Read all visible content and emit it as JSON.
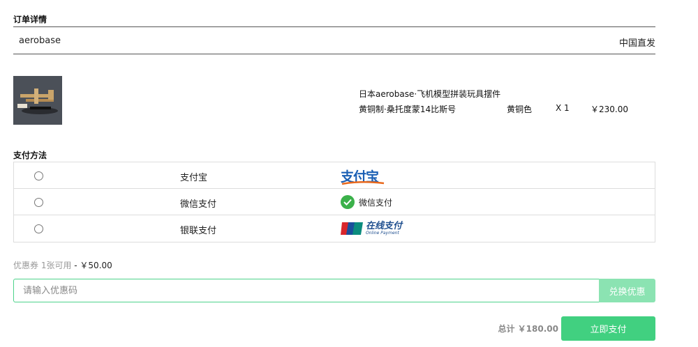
{
  "order": {
    "section_title": "订单详情",
    "store_name": "aerobase",
    "shipping": "中国直发",
    "product": {
      "name": "日本aerobase·飞机模型拼装玩具摆件",
      "variant": "黄铜制·桑托度蒙14比斯号",
      "color": "黄铜色",
      "quantity": "X 1",
      "price": "￥230.00"
    }
  },
  "payment": {
    "section_title": "支付方法",
    "methods": [
      {
        "label": "支付宝",
        "logo_text": "支付宝",
        "icon": "alipay-logo"
      },
      {
        "label": "微信支付",
        "logo_text": "微信支付",
        "icon": "wechat-logo"
      },
      {
        "label": "银联支付",
        "logo_text": "在线支付",
        "logo_sub": "Online Payment",
        "icon": "unionpay-logo"
      }
    ]
  },
  "coupon": {
    "label": "优惠券 1张可用",
    "amount": "- ￥50.00",
    "placeholder": "请输入优惠码",
    "button_label": "兑换优惠"
  },
  "checkout": {
    "total": "总计 ￥180.00",
    "pay_button": "立即支付"
  },
  "colors": {
    "accent": "#41d080",
    "accent_light": "#8be3b2",
    "alipay_blue": "#1a5fb4",
    "wechat_green": "#3bb14a"
  }
}
